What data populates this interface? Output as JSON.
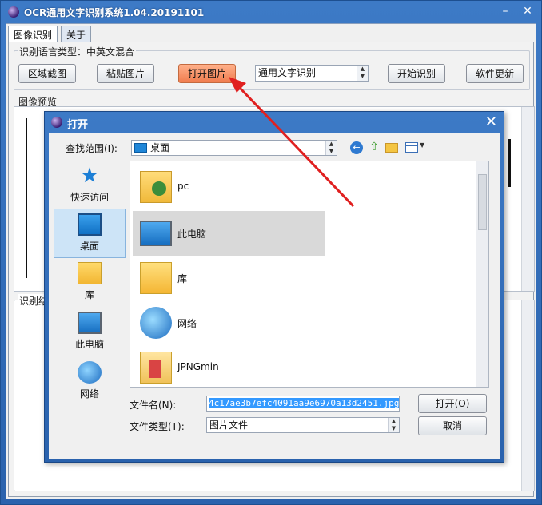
{
  "app": {
    "title": "OCR通用文字识别系统1.04.20191101",
    "minimize": "–",
    "close": "✕"
  },
  "tabs": [
    {
      "label": "图像识别"
    },
    {
      "label": "关于"
    }
  ],
  "language_group": {
    "label": "识别语言类型：中英文混合"
  },
  "toolbar": {
    "region_capture": "区域截图",
    "paste_image": "粘贴图片",
    "open_image": "打开图片",
    "ocr_mode": "通用文字识别",
    "start_ocr": "开始识别",
    "update": "软件更新"
  },
  "preview": {
    "label": "图像预览"
  },
  "result": {
    "label": "识别结"
  },
  "dialog": {
    "title": "打开",
    "close": "✕",
    "lookin_label": "查找范围(I):",
    "lookin_value": "桌面",
    "places": [
      {
        "label": "快速访问",
        "icon": "star-icon"
      },
      {
        "label": "桌面",
        "icon": "desktop-icon"
      },
      {
        "label": "库",
        "icon": "library-folder-icon"
      },
      {
        "label": "此电脑",
        "icon": "computer-icon"
      },
      {
        "label": "网络",
        "icon": "network-icon"
      }
    ],
    "files": [
      {
        "name": "pc",
        "icon": "user-folder-icon"
      },
      {
        "name": "此电脑",
        "icon": "computer-icon"
      },
      {
        "name": "库",
        "icon": "library-folder-icon"
      },
      {
        "name": "网络",
        "icon": "network-icon"
      },
      {
        "name": "JPNGmin",
        "icon": "folder-icon"
      }
    ],
    "filename_label": "文件名(N):",
    "filename_value": "4c17ae3b7efc4091aa9e6970a13d2451.jpg",
    "filetype_label": "文件类型(T):",
    "filetype_value": "图片文件",
    "open_button": "打开(O)",
    "cancel_button": "取消"
  },
  "colors": {
    "titlebar": "#2f69b6",
    "highlight_button": "#f48a5c",
    "annotation_arrow": "#e02020"
  }
}
